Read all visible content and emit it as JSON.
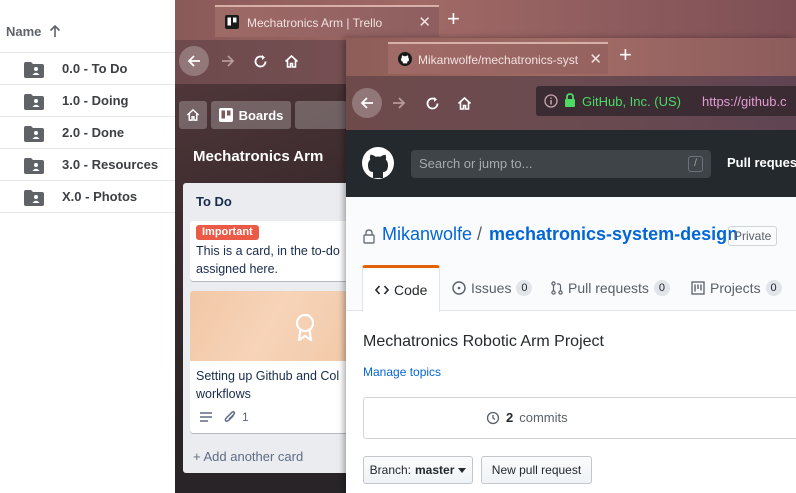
{
  "drive": {
    "header": {
      "label": "Name"
    },
    "files": [
      {
        "name": "0.0 - To Do"
      },
      {
        "name": "1.0 - Doing"
      },
      {
        "name": "2.0 - Done"
      },
      {
        "name": "3.0 - Resources"
      },
      {
        "name": "X.0 - Photos"
      }
    ]
  },
  "trello": {
    "tab_title": "Mechatronics Arm | Trello",
    "boards_label": "Boards",
    "board_name": "Mechatronics Arm",
    "list": {
      "name": "To Do",
      "cards": [
        {
          "label": "Important",
          "lines": [
            "This is a card, in the to-do",
            "assigned here."
          ]
        },
        {
          "lines": [
            "Setting up Github and Col",
            "workflows"
          ],
          "attachments": "1"
        }
      ],
      "add_card": "+ Add another card"
    }
  },
  "github": {
    "tab_title": "Mikanwolfe/mechatronics-syst",
    "url_org": "GitHub, Inc. (US)",
    "url": "https://github.c",
    "search_placeholder": "Search or jump to...",
    "search_key": "/",
    "nav_pulls": "Pull reques",
    "owner": "Mikanwolfe",
    "repo": "mechatronics-system-design",
    "visibility": "Private",
    "tabs": [
      {
        "label": "Code"
      },
      {
        "label": "Issues",
        "count": "0"
      },
      {
        "label": "Pull requests",
        "count": "0"
      },
      {
        "label": "Projects",
        "count": "0"
      }
    ],
    "description": "Mechatronics Robotic Arm Project",
    "manage_topics": "Manage topics",
    "commits_count": "2",
    "commits_label": "commits",
    "branch_label": "Branch:",
    "branch_name": "master",
    "new_pr": "New pull request"
  }
}
